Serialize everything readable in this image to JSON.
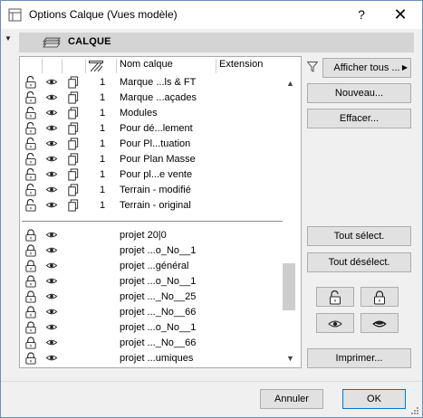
{
  "window": {
    "title": "Options Calque (Vues modèle)",
    "help_label": "?",
    "close_label": "✕"
  },
  "header": {
    "label": "CALQUE"
  },
  "columns": {
    "name": "Nom calque",
    "extension": "Extension"
  },
  "layers_top": [
    {
      "num": "1",
      "name": "Marque ...ls & FT"
    },
    {
      "num": "1",
      "name": "Marque ...açades"
    },
    {
      "num": "1",
      "name": "Modules"
    },
    {
      "num": "1",
      "name": "Pour dé...lement"
    },
    {
      "num": "1",
      "name": "Pour Pl...tuation"
    },
    {
      "num": "1",
      "name": "Pour Plan Masse"
    },
    {
      "num": "1",
      "name": "Pour pl...e vente"
    },
    {
      "num": "1",
      "name": "Terrain - modifié"
    },
    {
      "num": "1",
      "name": "Terrain - original"
    }
  ],
  "layers_bottom": [
    {
      "name": "projet 20|0"
    },
    {
      "name": "projet ...o_No__1"
    },
    {
      "name": "projet ...général"
    },
    {
      "name": "projet ...o_No__1"
    },
    {
      "name": "projet ..._No__25"
    },
    {
      "name": "projet ..._No__66"
    },
    {
      "name": "projet ...o_No__1"
    },
    {
      "name": "projet ..._No__66"
    },
    {
      "name": "projet ...umiques"
    }
  ],
  "buttons": {
    "show_all": "Afficher tous ...",
    "new": "Nouveau...",
    "delete": "Effacer...",
    "select_all": "Tout sélect.",
    "deselect_all": "Tout désélect.",
    "print": "Imprimer...",
    "cancel": "Annuler",
    "ok": "OK"
  },
  "colors": {
    "accent": "#0078d7",
    "header_band": "#d4d4d4",
    "window_bg": "#f0f0f0"
  }
}
